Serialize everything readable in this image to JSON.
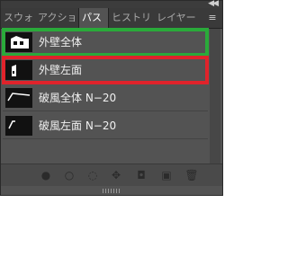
{
  "panel": {
    "tabs": [
      {
        "label": "スウォッ",
        "active": false
      },
      {
        "label": "アクショ",
        "active": false
      },
      {
        "label": "パス",
        "active": true
      },
      {
        "label": "ヒストリ",
        "active": false
      },
      {
        "label": "レイヤー",
        "active": false
      }
    ],
    "collapse_glyph": "◀◀",
    "menu_glyph": "≡",
    "paths": [
      {
        "label": "外壁全体",
        "thumbnail": "building-silhouette-white",
        "highlight": "#2aaa3a"
      },
      {
        "label": "外壁左面",
        "thumbnail": "building-left-face-white",
        "highlight": "#e0232b"
      },
      {
        "label": "破風全体 N−20",
        "thumbnail": "gable-line-white",
        "highlight": null
      },
      {
        "label": "破風左面 N−20",
        "thumbnail": "gable-left-line-white",
        "highlight": null
      }
    ],
    "bottom_buttons": [
      {
        "name": "fill-path-icon",
        "glyph": "●"
      },
      {
        "name": "stroke-path-icon",
        "glyph": "○"
      },
      {
        "name": "load-as-selection-icon",
        "glyph": "◌"
      },
      {
        "name": "make-path-from-selection-icon",
        "glyph": "✥"
      },
      {
        "name": "add-mask-icon",
        "glyph": "◘"
      },
      {
        "name": "new-path-icon",
        "glyph": "▣"
      },
      {
        "name": "delete-path-icon",
        "glyph": "🗑"
      }
    ],
    "colors": {
      "panel_bg": "#535353",
      "highlight_green": "#2aaa3a",
      "highlight_red": "#e0232b"
    }
  }
}
